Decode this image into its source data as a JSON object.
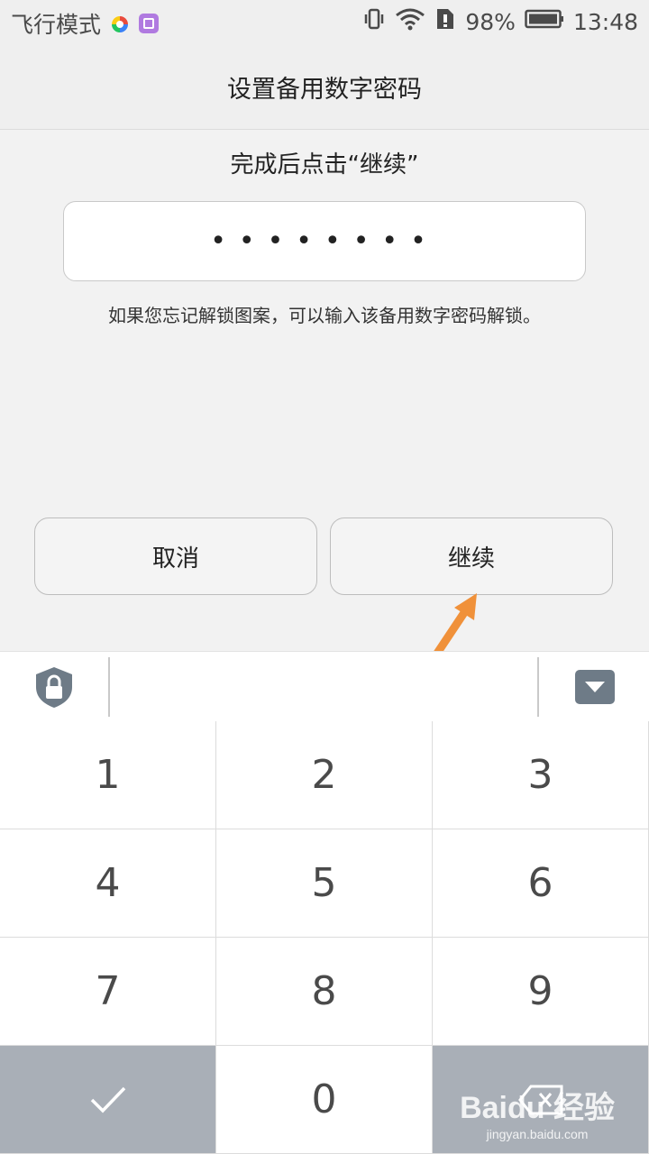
{
  "status_bar": {
    "mode": "飞行模式",
    "battery": "98%",
    "time": "13:48",
    "icons": [
      "app-icon-green",
      "gallery-icon",
      "vibrate-icon",
      "wifi-icon",
      "sim-warning-icon",
      "battery-icon"
    ]
  },
  "title": "设置备用数字密码",
  "instruction": "完成后点击“继续”",
  "pin_masked": "••••••••",
  "hint": "如果您忘记解锁图案，可以输入该备用数字密码解锁。",
  "buttons": {
    "cancel": "取消",
    "continue": "继续"
  },
  "keypad": {
    "keys": [
      "1",
      "2",
      "3",
      "4",
      "5",
      "6",
      "7",
      "8",
      "9",
      "✓",
      "0",
      "⌫"
    ]
  },
  "watermark": {
    "logo": "Baidu 经验",
    "url": "jingyan.baidu.com"
  },
  "colors": {
    "accent_arrow": "#f0913a",
    "keypad_dark": "#a9afb7",
    "keyboard_icon": "#6e7b87"
  }
}
